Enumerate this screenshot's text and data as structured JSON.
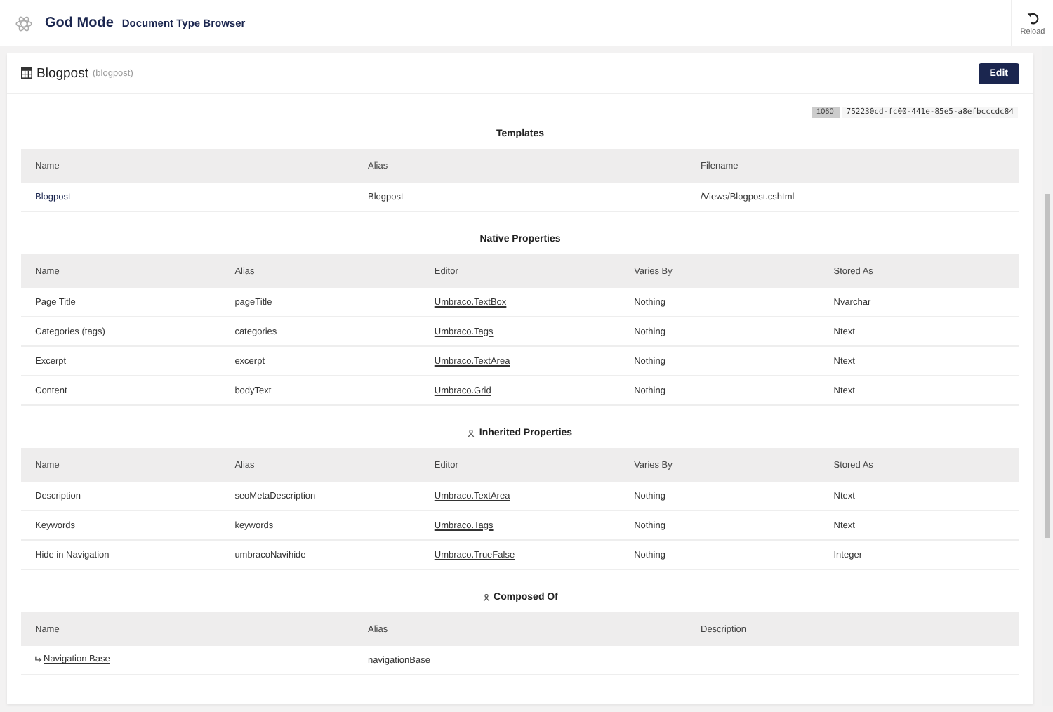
{
  "app": {
    "title": "God Mode",
    "subtitle": "Document Type Browser",
    "reload": "Reload"
  },
  "doc": {
    "name": "Blogpost",
    "alias": "(blogpost)",
    "edit": "Edit",
    "id": "1060",
    "key": "752230cd-fc00-441e-85e5-a8efbcccdc84"
  },
  "sections": [
    {
      "title": "Templates",
      "kind": "own",
      "columns": [
        "Name",
        "Alias",
        "Filename"
      ],
      "rows": [
        {
          "cells": [
            {
              "text": "Blogpost",
              "kind": "link"
            },
            {
              "text": "Blogpost",
              "kind": "text"
            },
            {
              "text": "/Views/Blogpost.cshtml",
              "kind": "text"
            }
          ]
        }
      ]
    },
    {
      "title": "Native Properties",
      "kind": "own",
      "columns": [
        "Name",
        "Alias",
        "Editor",
        "Varies By",
        "Stored As"
      ],
      "rows": [
        {
          "cells": [
            {
              "text": "Page Title",
              "kind": "text"
            },
            {
              "text": "pageTitle",
              "kind": "text"
            },
            {
              "text": "Umbraco.TextBox",
              "kind": "underline"
            },
            {
              "text": "Nothing",
              "kind": "text"
            },
            {
              "text": "Nvarchar",
              "kind": "text"
            }
          ]
        },
        {
          "cells": [
            {
              "text": "Categories (tags)",
              "kind": "text"
            },
            {
              "text": "categories",
              "kind": "text"
            },
            {
              "text": "Umbraco.Tags",
              "kind": "underline"
            },
            {
              "text": "Nothing",
              "kind": "text"
            },
            {
              "text": "Ntext",
              "kind": "text"
            }
          ]
        },
        {
          "cells": [
            {
              "text": "Excerpt",
              "kind": "text"
            },
            {
              "text": "excerpt",
              "kind": "text"
            },
            {
              "text": "Umbraco.TextArea",
              "kind": "underline"
            },
            {
              "text": "Nothing",
              "kind": "text"
            },
            {
              "text": "Ntext",
              "kind": "text"
            }
          ]
        },
        {
          "cells": [
            {
              "text": "Content",
              "kind": "text"
            },
            {
              "text": "bodyText",
              "kind": "text"
            },
            {
              "text": "Umbraco.Grid",
              "kind": "underline"
            },
            {
              "text": "Nothing",
              "kind": "text"
            },
            {
              "text": "Ntext",
              "kind": "text"
            }
          ]
        }
      ]
    },
    {
      "title": "Inherited Properties",
      "kind": "inherited",
      "columns": [
        "Name",
        "Alias",
        "Editor",
        "Varies By",
        "Stored As"
      ],
      "rows": [
        {
          "cells": [
            {
              "text": "Description",
              "kind": "text"
            },
            {
              "text": "seoMetaDescription",
              "kind": "text"
            },
            {
              "text": "Umbraco.TextArea",
              "kind": "underline"
            },
            {
              "text": "Nothing",
              "kind": "text"
            },
            {
              "text": "Ntext",
              "kind": "text"
            }
          ]
        },
        {
          "cells": [
            {
              "text": "Keywords",
              "kind": "text"
            },
            {
              "text": "keywords",
              "kind": "text"
            },
            {
              "text": "Umbraco.Tags",
              "kind": "underline"
            },
            {
              "text": "Nothing",
              "kind": "text"
            },
            {
              "text": "Ntext",
              "kind": "text"
            }
          ]
        },
        {
          "cells": [
            {
              "text": "Hide in Navigation",
              "kind": "text"
            },
            {
              "text": "umbracoNavihide",
              "kind": "text"
            },
            {
              "text": "Umbraco.TrueFalse",
              "kind": "underline"
            },
            {
              "text": "Nothing",
              "kind": "text"
            },
            {
              "text": "Integer",
              "kind": "text"
            }
          ]
        }
      ]
    },
    {
      "title": "Composed Of",
      "kind": "inherited",
      "columns": [
        "Name",
        "Alias",
        "Description"
      ],
      "rows": [
        {
          "cells": [
            {
              "text": "Navigation Base",
              "kind": "composition"
            },
            {
              "text": "navigationBase",
              "kind": "text"
            }
          ]
        }
      ]
    }
  ]
}
